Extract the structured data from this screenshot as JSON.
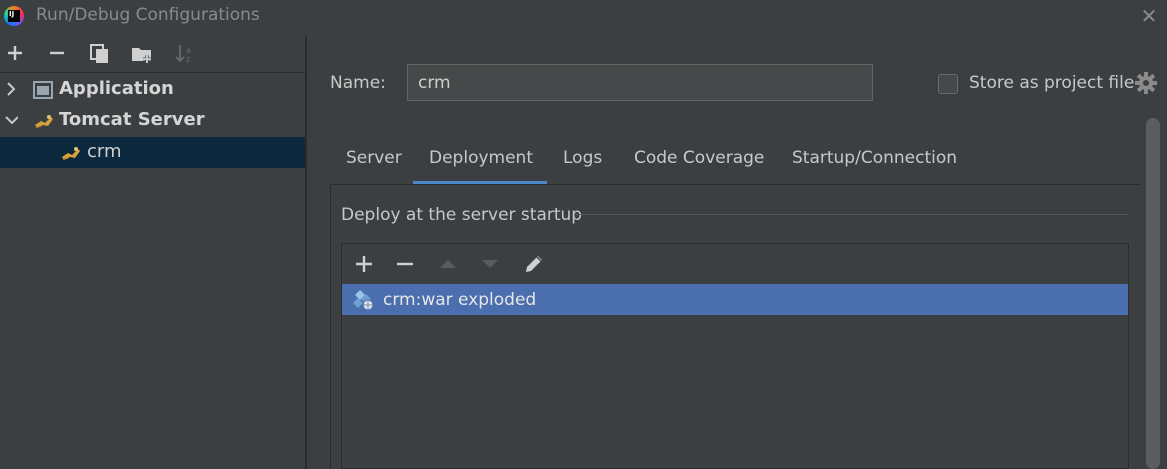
{
  "window": {
    "title": "Run/Debug Configurations",
    "logo_text": "IJ",
    "close_symbol": "✕"
  },
  "left_toolbar": {
    "icons": [
      "add-icon",
      "remove-icon",
      "copy-icon",
      "folder-add-icon",
      "sort-icon"
    ]
  },
  "tree": {
    "items": [
      {
        "label": "Application",
        "expanded": false,
        "bold": true,
        "icon": "application-icon"
      },
      {
        "label": "Tomcat Server",
        "expanded": true,
        "bold": true,
        "icon": "tomcat-icon"
      },
      {
        "label": "crm",
        "selected": true,
        "bold": false,
        "icon": "tomcat-icon"
      }
    ]
  },
  "form": {
    "name_label": "Name:",
    "name_value": "crm",
    "store_label": "Store as project file",
    "store_checked": false
  },
  "tabs": [
    {
      "label": "Server",
      "active": false
    },
    {
      "label": "Deployment",
      "active": true
    },
    {
      "label": "Logs",
      "active": false
    },
    {
      "label": "Code Coverage",
      "active": false
    },
    {
      "label": "Startup/Connection",
      "active": false
    }
  ],
  "deployment": {
    "section_title": "Deploy at the server startup",
    "toolbar_icons": [
      "add-icon",
      "remove-icon",
      "move-up-icon",
      "move-down-icon",
      "edit-icon"
    ],
    "artifacts": [
      {
        "label": "crm:war exploded",
        "selected": true
      }
    ]
  },
  "colors": {
    "background": "#3c3f41",
    "selection_tree": "#0d293e",
    "selection_list": "#4b6eaf",
    "tab_accent": "#4a88c7"
  }
}
